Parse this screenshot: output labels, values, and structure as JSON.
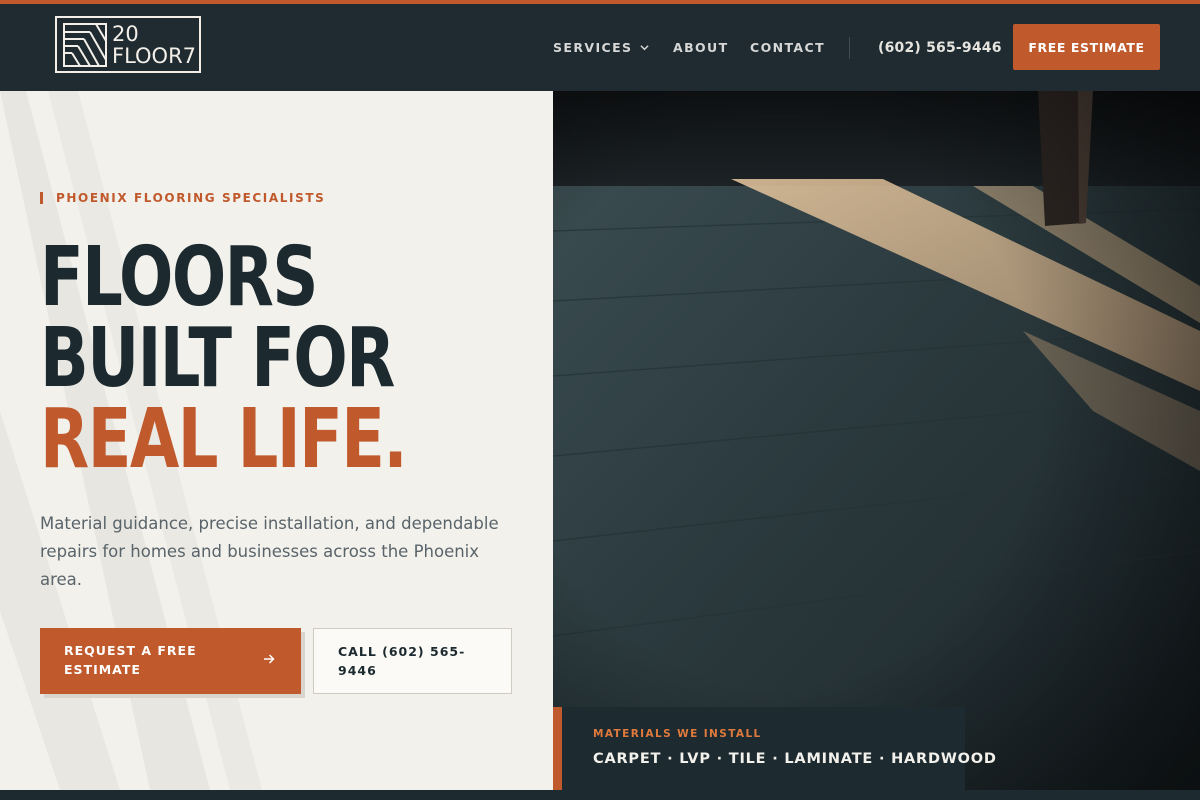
{
  "brand": {
    "logo_line1": "20",
    "logo_line2": "FLOOR7"
  },
  "nav": {
    "items": [
      {
        "label": "SERVICES",
        "has_dropdown": true
      },
      {
        "label": "ABOUT"
      },
      {
        "label": "CONTACT"
      }
    ],
    "phone": "(602) 565-9446",
    "cta_label": "FREE ESTIMATE"
  },
  "hero": {
    "eyebrow": "PHOENIX FLOORING SPECIALISTS",
    "headline_line1": "FLOORS",
    "headline_line2": "BUILT FOR",
    "headline_line3": "REAL LIFE.",
    "description": "Material guidance, precise installation, and dependable repairs for homes and businesses across the Phoenix area.",
    "primary_cta_line1": "REQUEST A FREE",
    "primary_cta_line2": "ESTIMATE",
    "secondary_cta_line1": "CALL (602) 565-",
    "secondary_cta_line2": "9446"
  },
  "materials": {
    "label": "MATERIALS WE INSTALL",
    "list": "CARPET · LVP · TILE · LAMINATE · HARDWOOD"
  },
  "icons": {
    "dropdown": "chevron-down-icon",
    "arrow": "arrow-right-icon",
    "logo_mark": "floor-planks-icon"
  },
  "colors": {
    "accent": "#c0592b",
    "dark": "#1f2b31",
    "light_bg": "#f3f1ec"
  }
}
